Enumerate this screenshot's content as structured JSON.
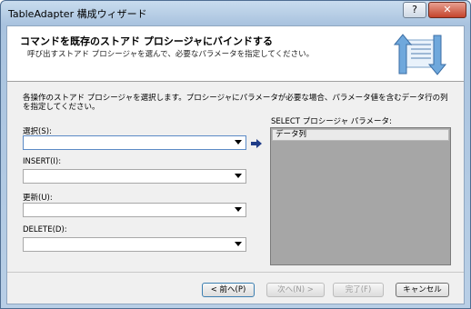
{
  "window": {
    "title": "TableAdapter 構成ウィザード",
    "help": "?",
    "close": "✕"
  },
  "header": {
    "title": "コマンドを既存のストアド プロシージャにバインドする",
    "subtitle": "呼び出すストアド プロシージャを選んで、必要なパラメータを指定してください。",
    "icon": "wizard-binding-icon"
  },
  "description": "各操作のストアド プロシージャを選択します。プロシージャにパラメータが必要な場合、パラメータ値を含むデータ行の列を指定してください。",
  "fields": {
    "select_label": "選択(S):",
    "insert_label": "INSERT(I):",
    "update_label": "更新(U):",
    "delete_label": "DELETE(D):",
    "select_value": "",
    "insert_value": "",
    "update_value": "",
    "delete_value": ""
  },
  "params": {
    "label": "SELECT プロシージャ パラメータ:",
    "column_header": "データ列"
  },
  "buttons": {
    "back": "< 前へ(P)",
    "next": "次へ(N) >",
    "finish": "完了(F)",
    "cancel": "キャンセル"
  }
}
